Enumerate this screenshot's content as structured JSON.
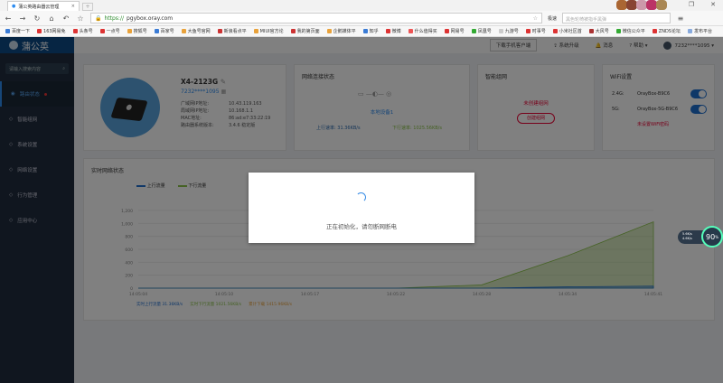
{
  "browser": {
    "tab_title": "蒲公英路由器云管理",
    "url_scheme": "https://",
    "url_host": "pgybox.oray.com",
    "speed_label": "极速",
    "search_placeholder": "黑色轮椅被指手黑弹",
    "bookmarks": [
      "百度一下",
      "163网易免",
      "头条号",
      "一点号",
      "搜狐号",
      "百家号",
      "大鱼号官网",
      "新浪看点平",
      "MIUI官方论",
      "我的第页面",
      "企鹅媒体平",
      "知乎",
      "微博",
      "什么值得买",
      "网易号",
      "凤凰号",
      "九游号",
      "时事号",
      "小米社区首",
      "大风号",
      "微信公众平",
      "ZNDS论坛",
      "发布平台"
    ]
  },
  "app": {
    "logo": "蒲公英",
    "search_placeholder": "请输入搜索内容",
    "sidebar": [
      {
        "label": "路由状态"
      },
      {
        "label": "智能组网"
      },
      {
        "label": "系统设置"
      },
      {
        "label": "网络设置"
      },
      {
        "label": "行为管理"
      },
      {
        "label": "应用中心"
      }
    ],
    "top": {
      "download": "下载手机客户端",
      "upgrade": "系统升级",
      "messages": "消息",
      "help": "帮助",
      "user": "7232****1095"
    },
    "device": {
      "name": "X4-2123G",
      "sn": "7232****1095",
      "rows": [
        {
          "k": "广域网IP地址:",
          "v": "10.43.119.163"
        },
        {
          "k": "局域网IP地址:",
          "v": "10.168.1.1"
        },
        {
          "k": "MAC地址:",
          "v": "86:ad:e7:33:22:19"
        },
        {
          "k": "路由器系统版本:",
          "v": "3.4.6 稳定版"
        }
      ]
    },
    "net": {
      "title": "网络连接状态",
      "devices": "本地设备1",
      "up": "上行速率: 31.36KB/s",
      "down": "下行速率: 1025.56KB/s"
    },
    "smart": {
      "title": "智能组网",
      "status": "未创建组网",
      "button": "创建组网"
    },
    "wifi": {
      "title": "WiFi设置",
      "rows": [
        {
          "band": "2.4G:",
          "ssid": "OrayBox-B9C6",
          "on": true
        },
        {
          "band": "5G:",
          "ssid": "OrayBox-5G-B9C6",
          "on": true
        }
      ],
      "warn": "未设置WiFi密码"
    },
    "chart_title": "实时网络状态",
    "footer": {
      "up": "实时上行流量 31.36KB/s",
      "down": "实时下行流量 1021.56KB/s",
      "total": "累计下载 1415.96KB/s"
    }
  },
  "chart_data": {
    "type": "area",
    "legend": [
      "上行流量",
      "下行流量"
    ],
    "legend_position": "top-left",
    "ylim": [
      0,
      1200
    ],
    "yticks": [
      "0",
      "200",
      "400",
      "600",
      "800",
      "1,000",
      "1,200"
    ],
    "x": [
      "14:05:04",
      "14:05:10",
      "14:05:17",
      "14:05:22",
      "14:05:28",
      "14:05:34",
      "14:05:41"
    ],
    "series": [
      {
        "name": "上行流量",
        "color": "#1f6fd0",
        "values": [
          0,
          0,
          0,
          0,
          0,
          20,
          31
        ]
      },
      {
        "name": "下行流量",
        "color": "#8bc34a",
        "values": [
          0,
          0,
          0,
          0,
          50,
          500,
          1025
        ]
      }
    ]
  },
  "modal": {
    "message": "正在初始化，请勿断网断电"
  },
  "gauge": {
    "percent": "90",
    "unit": "%",
    "up": "5.6K/s",
    "down": "4.6K/s"
  }
}
